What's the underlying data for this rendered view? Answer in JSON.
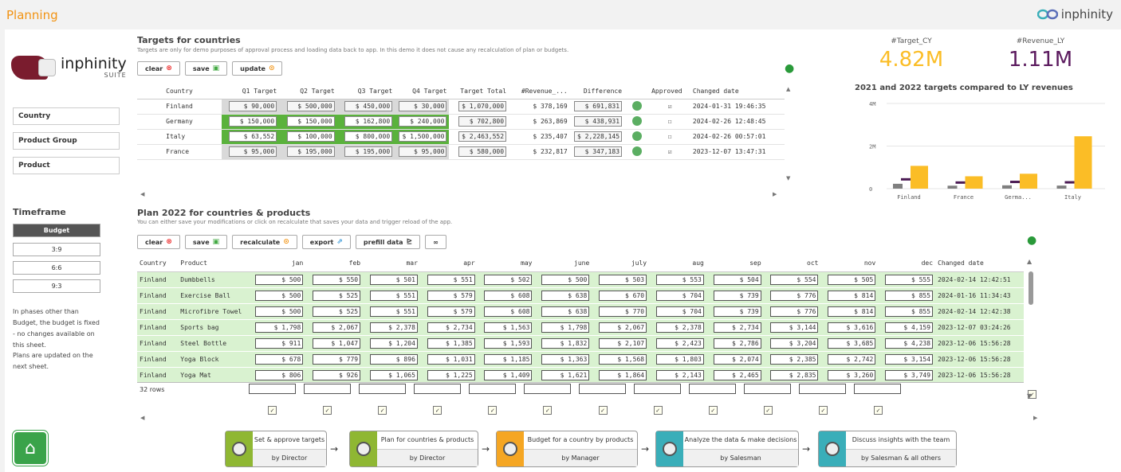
{
  "app_title": "Planning",
  "brand": "inphinity",
  "logo": {
    "name": "inphinity",
    "sub": "SUITE"
  },
  "filters": [
    "Country",
    "Product Group",
    "Product"
  ],
  "timeframe": {
    "title": "Timeframe",
    "phases": [
      "Budget",
      "3:9",
      "6:6",
      "9:3"
    ],
    "note1": "In phases other than Budget, the budget is fixed - no changes available on this sheet.",
    "note2": "Plans are updated on the next sheet."
  },
  "targets": {
    "title": "Targets for countries",
    "subtitle": "Targets are only for demo purposes of approval process and loading data back to app. In this demo it does not cause any recalculation of plan or budgets.",
    "buttons": {
      "clear": "clear",
      "save": "save",
      "update": "update"
    },
    "headers": [
      "Country",
      "Q1 Target",
      "Q2 Target",
      "Q3 Target",
      "Q4 Target",
      "Target Total",
      "#Revenue_...",
      "Difference",
      "",
      "Approved",
      "Changed date"
    ],
    "rows": [
      {
        "country": "Finland",
        "q1": "$ 90,000",
        "q2": "$ 500,000",
        "q3": "$ 450,000",
        "q4": "$ 30,000",
        "total": "$ 1,070,000",
        "rev": "$ 378,169",
        "diff": "$ 691,831",
        "approved": "☑",
        "date": "2024-01-31 19:46:35",
        "green": []
      },
      {
        "country": "Germany",
        "q1": "$ 150,000",
        "q2": "$ 150,000",
        "q3": "$ 162,800",
        "q4": "$ 240,000",
        "total": "$ 702,800",
        "rev": "$ 263,869",
        "diff": "$ 438,931",
        "approved": "☐",
        "date": "2024-02-26 12:48:45",
        "green": [
          1,
          2,
          3,
          4
        ]
      },
      {
        "country": "Italy",
        "q1": "$ 63,552",
        "q2": "$ 100,000",
        "q3": "$ 800,000",
        "q4": "$ 1,500,000",
        "total": "$ 2,463,552",
        "rev": "$ 235,407",
        "diff": "$ 2,228,145",
        "approved": "☐",
        "date": "2024-02-26 00:57:01",
        "green": [
          1,
          2,
          3,
          4
        ]
      },
      {
        "country": "France",
        "q1": "$ 95,000",
        "q2": "$ 195,000",
        "q3": "$ 195,000",
        "q4": "$ 95,000",
        "total": "$ 580,000",
        "rev": "$ 232,817",
        "diff": "$ 347,183",
        "approved": "☑",
        "date": "2023-12-07 13:47:31",
        "green": []
      }
    ]
  },
  "kpis": {
    "target_label": "#Target_CY",
    "target_value": "4.82M",
    "revenue_label": "#Revenue_LY",
    "revenue_value": "1.11M",
    "target_color": "#fbbd26",
    "revenue_color": "#5b1a5e"
  },
  "chart_data": {
    "type": "bar",
    "title": "2021 and 2022 targets compared to LY revenues",
    "categories": [
      "Finland",
      "France",
      "Germa...",
      "Italy"
    ],
    "series": [
      {
        "values": [
          0.38,
          0.23,
          0.26,
          0.24
        ]
      },
      {
        "values": [
          0.38,
          0.23,
          0.26,
          0.24
        ]
      },
      {
        "values": [
          1.07,
          0.58,
          0.7,
          2.46
        ]
      }
    ],
    "yticks": [
      "4M",
      "2M",
      "0"
    ],
    "ylim": [
      0,
      4
    ]
  },
  "plan": {
    "title": "Plan 2022 for countries & products",
    "subtitle": "You can either save your modifications or click on recalculate that saves your data and trigger reload of the app.",
    "buttons": {
      "clear": "clear",
      "save": "save",
      "recalculate": "recalculate",
      "export": "export",
      "prefill": "prefill data",
      "more": "∞"
    },
    "headers": [
      "Country",
      "Product",
      "jan",
      "feb",
      "mar",
      "apr",
      "may",
      "june",
      "july",
      "aug",
      "sep",
      "oct",
      "nov",
      "dec",
      "Changed date"
    ],
    "rows": [
      {
        "c": "Finland",
        "p": "Dumbbells",
        "v": [
          "$ 500",
          "$ 550",
          "$ 501",
          "$ 551",
          "$ 502",
          "$ 500",
          "$ 503",
          "$ 553",
          "$ 504",
          "$ 554",
          "$ 505",
          "$ 555"
        ],
        "d": "2024-02-14 12:42:51"
      },
      {
        "c": "Finland",
        "p": "Exercise Ball",
        "v": [
          "$ 500",
          "$ 525",
          "$ 551",
          "$ 579",
          "$ 608",
          "$ 638",
          "$ 670",
          "$ 704",
          "$ 739",
          "$ 776",
          "$ 814",
          "$ 855"
        ],
        "d": "2024-01-16 11:34:43"
      },
      {
        "c": "Finland",
        "p": "Microfibre Towel",
        "v": [
          "$ 500",
          "$ 525",
          "$ 551",
          "$ 579",
          "$ 608",
          "$ 638",
          "$ 770",
          "$ 704",
          "$ 739",
          "$ 776",
          "$ 814",
          "$ 855"
        ],
        "d": "2024-02-14 12:42:38"
      },
      {
        "c": "Finland",
        "p": "Sports bag",
        "v": [
          "$ 1,798",
          "$ 2,067",
          "$ 2,378",
          "$ 2,734",
          "$ 1,563",
          "$ 1,798",
          "$ 2,067",
          "$ 2,378",
          "$ 2,734",
          "$ 3,144",
          "$ 3,616",
          "$ 4,159"
        ],
        "d": "2023-12-07 03:24:26"
      },
      {
        "c": "Finland",
        "p": "Steel Bottle",
        "v": [
          "$ 911",
          "$ 1,047",
          "$ 1,204",
          "$ 1,385",
          "$ 1,593",
          "$ 1,832",
          "$ 2,107",
          "$ 2,423",
          "$ 2,786",
          "$ 3,204",
          "$ 3,685",
          "$ 4,238"
        ],
        "d": "2023-12-06 15:56:28"
      },
      {
        "c": "Finland",
        "p": "Yoga Block",
        "v": [
          "$ 678",
          "$ 779",
          "$ 896",
          "$ 1,031",
          "$ 1,185",
          "$ 1,363",
          "$ 1,568",
          "$ 1,803",
          "$ 2,074",
          "$ 2,385",
          "$ 2,742",
          "$ 3,154"
        ],
        "d": "2023-12-06 15:56:28"
      },
      {
        "c": "Finland",
        "p": "Yoga Mat",
        "v": [
          "$ 806",
          "$ 926",
          "$ 1,065",
          "$ 1,225",
          "$ 1,409",
          "$ 1,621",
          "$ 1,864",
          "$ 2,143",
          "$ 2,465",
          "$ 2,835",
          "$ 3,260",
          "$ 3,749"
        ],
        "d": "2023-12-06 15:56:28"
      }
    ],
    "rowcount": "32 rows"
  },
  "flow": [
    {
      "t": "Set & approve targets",
      "b": "by Director",
      "color": "#8fb733"
    },
    {
      "t": "Plan for countries & products",
      "b": "by Director",
      "color": "#8fb733"
    },
    {
      "t": "Budget for a country by products",
      "b": "by Manager",
      "color": "#f5a623"
    },
    {
      "t": "Analyze the data & make decisions",
      "b": "by Salesman",
      "color": "#3aaeb9"
    },
    {
      "t": "Discuss insights with the team",
      "b": "by Salesman & all others",
      "color": "#3aaeb9"
    }
  ]
}
